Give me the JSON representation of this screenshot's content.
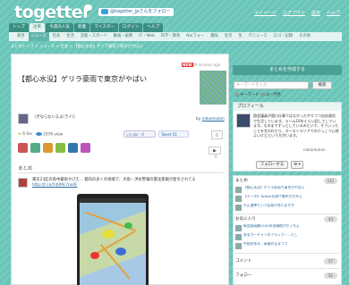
{
  "header": {
    "logo": "togetter",
    "follow_label": "@togetter_jpさんをフォロー",
    "links": [
      "マイページ",
      "ログアウト",
      "設定",
      "ヘルプ"
    ]
  },
  "nav_main": [
    "トップ",
    "注目",
    "今週の人気",
    "新着",
    "マイスター",
    "ログイン",
    "ヘルプ"
  ],
  "nav_sub": [
    "政治",
    "ニュース",
    "社会",
    "生活",
    "芸能・スポーツ",
    "動画・画像",
    "IT・Web",
    "科学・教育",
    "Naiフォー",
    "趣味",
    "生活",
    "生",
    "ITニュース",
    "ロゴ・記録",
    "その他"
  ],
  "breadcrumb": "まとめトップ > ニュース > 社会 > 【都心水没】ゲリラ豪雨で東京がやばい",
  "article": {
    "new_badge": "NEW",
    "time_ago": "46 minutes ago",
    "title": "【都心水没】ゲリラ豪雨で東京がやばい",
    "subtitle": "（犬ならないるよ(ライ)）",
    "byline_prefix": "by",
    "author": "nakamukan",
    "fav_count": "6 fav",
    "views": "1076 view",
    "like_label": "いいね！ 0",
    "tweet_label": "Tweet 41",
    "fav_box": "6",
    "expand_label": "▶",
    "counter": "0",
    "section": "まとめ",
    "tweet_text": "東京23区の高中豪雨すげえ… 都内の多くの地域で、大雨・洪水警報の雷注意報が発令されてる",
    "tweet_link": "http://t.co/YdUMc7no4F"
  },
  "sidebar": {
    "create_label": "まとめを作成する",
    "search_placeholder": "キーワードを入力",
    "search_button": "検索",
    "radio_keyword": "キーワード",
    "radio_user": "ユーザ名",
    "profile_title": "プロフィール",
    "profile_text": "国会議員が超ロ仕事ではなかったやりつつ自由発信で生活しています。ラーム10年ぐらい話してしています。ものまでずっとしているみたいで、そういったことを言われたり、オーストラリアでのけっこう心地よいけどという方がいます。",
    "profile_user": "nakamukan",
    "follow_button": "フォローする",
    "gear_button": "⚙ ▾",
    "sections": [
      {
        "title": "まとめ",
        "count": "111",
        "items": [
          "【都心水没】ゲリラ豪雨で東京がやばい",
          "【データ】Twitter計測で都市が大炎上",
          "不正選挙という記録がありますが"
        ]
      },
      {
        "title": "お気に入り",
        "count": "43",
        "items": [
          "新型録画機2200の低価格がだっちょ",
          "あるカーチャンのブラック・…とし",
          "中国のある…高値のままつつ"
        ]
      },
      {
        "title": "コメント",
        "count": "57",
        "items": []
      },
      {
        "title": "フォロー",
        "count": "52",
        "items": []
      }
    ]
  }
}
